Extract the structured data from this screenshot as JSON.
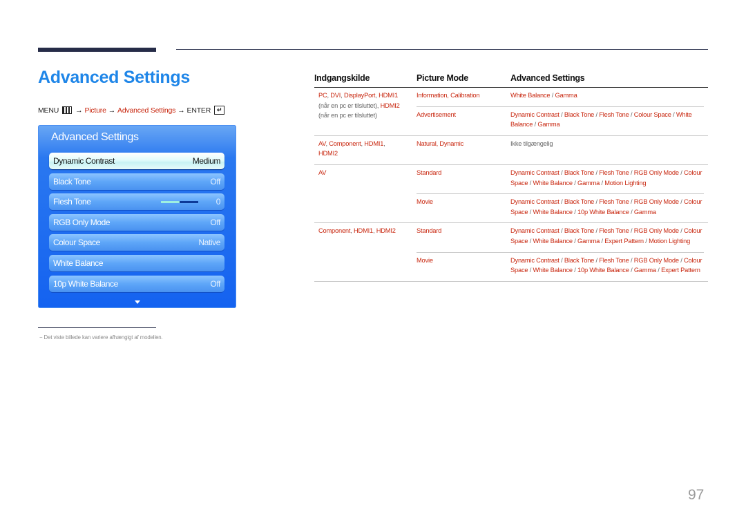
{
  "header": {
    "title": "Advanced Settings"
  },
  "menu_path": {
    "menu": "MENU",
    "arrow": "→",
    "picture": "Picture",
    "advanced": "Advanced Settings",
    "enter": "ENTER"
  },
  "osd": {
    "title": "Advanced Settings",
    "items": [
      {
        "label": "Dynamic Contrast",
        "value": "Medium",
        "selected": true
      },
      {
        "label": "Black Tone",
        "value": "Off"
      },
      {
        "label": "Flesh Tone",
        "value": "0",
        "slider_fraction": 0.5
      },
      {
        "label": "RGB Only Mode",
        "value": "Off"
      },
      {
        "label": "Colour Space",
        "value": "Native"
      },
      {
        "label": "White Balance",
        "value": ""
      },
      {
        "label": "10p White Balance",
        "value": "Off"
      }
    ]
  },
  "footnote": "Det viste billede kan variere afhængigt af modellen.",
  "footnote_dash": "−",
  "table": {
    "headers": [
      "Indgangskilde",
      "Picture Mode",
      "Advanced Settings"
    ],
    "groups": [
      {
        "source_lines": [
          [
            {
              "t": "PC",
              "r": true
            },
            {
              "t": ", ",
              "r": false
            },
            {
              "t": "DVI",
              "r": true
            },
            {
              "t": ", ",
              "r": false
            },
            {
              "t": "DisplayPort",
              "r": true
            },
            {
              "t": ", ",
              "r": false
            },
            {
              "t": "HDMI1",
              "r": true
            }
          ],
          [
            {
              "t": "(når en pc er tilsluttet), ",
              "r": false
            },
            {
              "t": "HDMI2",
              "r": true
            }
          ],
          [
            {
              "t": "(når en pc er tilsluttet)",
              "r": false
            }
          ]
        ],
        "rows": [
          {
            "mode": "Information, Calibration",
            "settings": "White Balance / Gamma"
          },
          {
            "mode": "Advertisement",
            "settings": "Dynamic Contrast / Black Tone / Flesh Tone / Colour Space / White Balance / Gamma"
          }
        ]
      },
      {
        "source_lines": [
          [
            {
              "t": "AV",
              "r": true
            },
            {
              "t": ", ",
              "r": false
            },
            {
              "t": "Component",
              "r": true
            },
            {
              "t": ", ",
              "r": false
            },
            {
              "t": "HDMI1",
              "r": true
            },
            {
              "t": ",",
              "r": false
            }
          ],
          [
            {
              "t": "HDMI2",
              "r": true
            }
          ]
        ],
        "rows": [
          {
            "mode": "Natural, Dynamic",
            "settings": "Ikke tilgængelig",
            "na": true
          }
        ]
      },
      {
        "source_lines": [
          [
            {
              "t": "AV",
              "r": true
            }
          ]
        ],
        "rows": [
          {
            "mode": "Standard",
            "settings": "Dynamic Contrast / Black Tone / Flesh Tone / RGB Only Mode / Colour Space / White Balance / Gamma / Motion Lighting"
          },
          {
            "mode": "Movie",
            "settings": "Dynamic Contrast / Black Tone / Flesh Tone / RGB Only Mode / Colour Space / White Balance / 10p White Balance / Gamma"
          }
        ]
      },
      {
        "source_lines": [
          [
            {
              "t": "Component",
              "r": true
            },
            {
              "t": ", ",
              "r": false
            },
            {
              "t": "HDMI1",
              "r": true
            },
            {
              "t": ", ",
              "r": false
            },
            {
              "t": "HDMI2",
              "r": true
            }
          ]
        ],
        "rows": [
          {
            "mode": "Standard",
            "settings": "Dynamic Contrast / Black Tone / Flesh Tone / RGB Only Mode / Colour Space / White Balance / Gamma / Expert Pattern / Motion Lighting"
          },
          {
            "mode": "Movie",
            "settings": "Dynamic Contrast / Black Tone / Flesh Tone / RGB Only Mode / Colour Space / White Balance / 10p White Balance / Gamma / Expert Pattern"
          }
        ]
      }
    ]
  },
  "page_number": "97",
  "colors": {
    "title_blue": "#1f86e8",
    "accent_red": "#c8260e",
    "osd_blue": "#1462f0",
    "rule_dark": "#262c48"
  }
}
